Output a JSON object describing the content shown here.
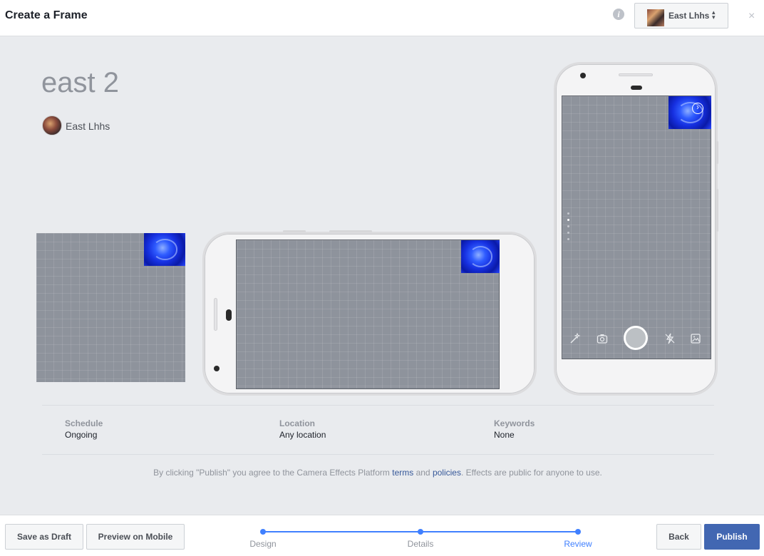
{
  "header": {
    "title": "Create a Frame",
    "info_icon": "info-icon",
    "account_name": "East Lhhs",
    "account_caret": "⬍",
    "close_symbol": "×"
  },
  "frame": {
    "name": "east 2",
    "owner_name": "East Lhhs"
  },
  "camera_toolbar": {
    "icons": [
      "magic-wand-icon",
      "flip-camera-icon",
      "shutter-button",
      "flash-icon",
      "gallery-icon"
    ]
  },
  "details": {
    "schedule_label": "Schedule",
    "schedule_value": "Ongoing",
    "location_label": "Location",
    "location_value": "Any location",
    "keywords_label": "Keywords",
    "keywords_value": "None"
  },
  "agreement": {
    "prefix": "By clicking \"Publish\" you agree to the Camera Effects Platform ",
    "terms_link": "terms",
    "and": " and ",
    "policies_link": "policies",
    "suffix": ". Effects are public for anyone to use."
  },
  "footer": {
    "save_draft": "Save as Draft",
    "preview_mobile": "Preview on Mobile",
    "steps": [
      "Design",
      "Details",
      "Review"
    ],
    "active_step": "Review",
    "back": "Back",
    "publish": "Publish"
  },
  "colors": {
    "accent": "#4080ff",
    "publish": "#4267b2",
    "link": "#365899",
    "canvas": "#8e939c"
  }
}
